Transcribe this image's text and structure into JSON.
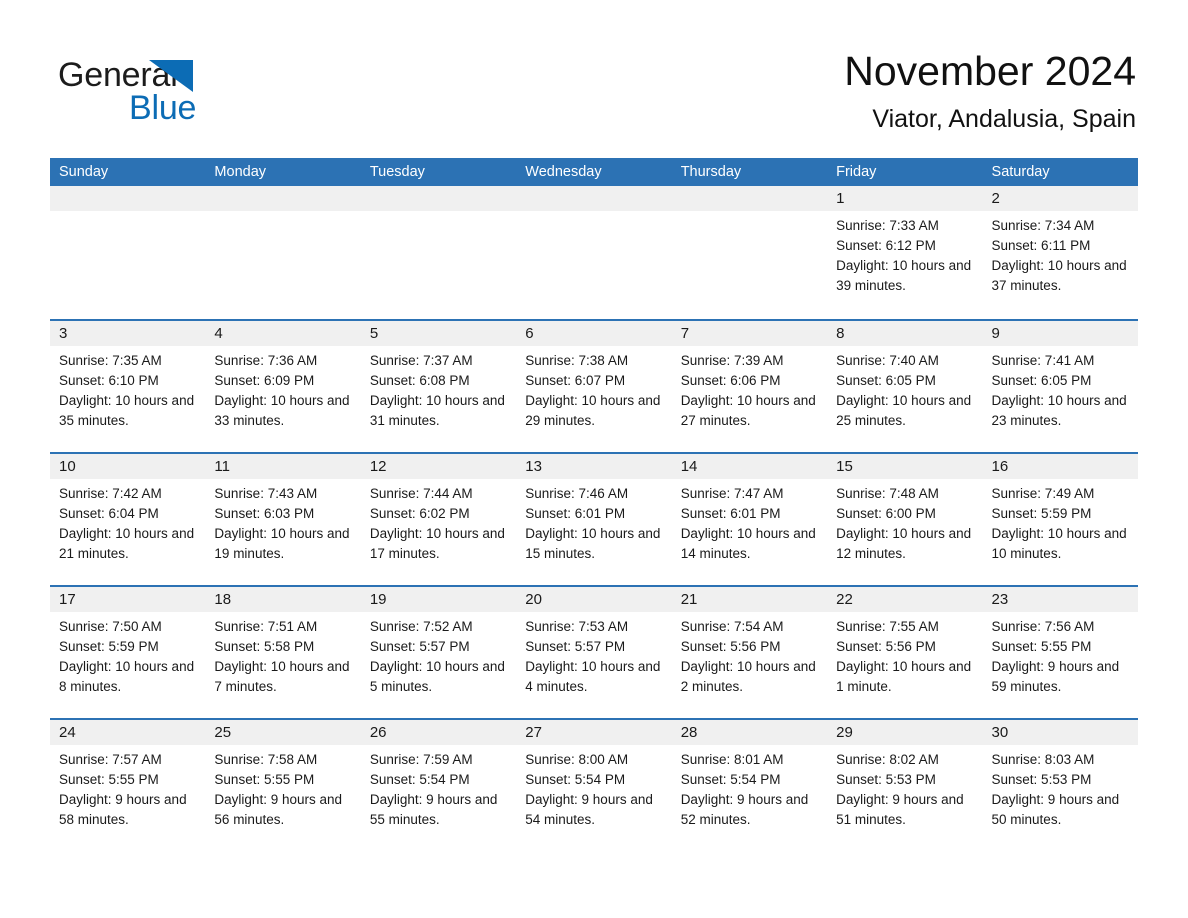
{
  "brand": {
    "name_part1": "General",
    "name_part2": "Blue",
    "accent_color": "#0c6cb5"
  },
  "header": {
    "month_title": "November 2024",
    "location": "Viator, Andalusia, Spain"
  },
  "theme": {
    "header_blue": "#2c72b4",
    "day_band_gray": "#f0f0f0",
    "row_border_blue": "#2c72b4"
  },
  "weekdays": [
    "Sunday",
    "Monday",
    "Tuesday",
    "Wednesday",
    "Thursday",
    "Friday",
    "Saturday"
  ],
  "weeks": [
    [
      {
        "day": "",
        "sunrise": "",
        "sunset": "",
        "daylight": ""
      },
      {
        "day": "",
        "sunrise": "",
        "sunset": "",
        "daylight": ""
      },
      {
        "day": "",
        "sunrise": "",
        "sunset": "",
        "daylight": ""
      },
      {
        "day": "",
        "sunrise": "",
        "sunset": "",
        "daylight": ""
      },
      {
        "day": "",
        "sunrise": "",
        "sunset": "",
        "daylight": ""
      },
      {
        "day": "1",
        "sunrise": "Sunrise: 7:33 AM",
        "sunset": "Sunset: 6:12 PM",
        "daylight": "Daylight: 10 hours and 39 minutes."
      },
      {
        "day": "2",
        "sunrise": "Sunrise: 7:34 AM",
        "sunset": "Sunset: 6:11 PM",
        "daylight": "Daylight: 10 hours and 37 minutes."
      }
    ],
    [
      {
        "day": "3",
        "sunrise": "Sunrise: 7:35 AM",
        "sunset": "Sunset: 6:10 PM",
        "daylight": "Daylight: 10 hours and 35 minutes."
      },
      {
        "day": "4",
        "sunrise": "Sunrise: 7:36 AM",
        "sunset": "Sunset: 6:09 PM",
        "daylight": "Daylight: 10 hours and 33 minutes."
      },
      {
        "day": "5",
        "sunrise": "Sunrise: 7:37 AM",
        "sunset": "Sunset: 6:08 PM",
        "daylight": "Daylight: 10 hours and 31 minutes."
      },
      {
        "day": "6",
        "sunrise": "Sunrise: 7:38 AM",
        "sunset": "Sunset: 6:07 PM",
        "daylight": "Daylight: 10 hours and 29 minutes."
      },
      {
        "day": "7",
        "sunrise": "Sunrise: 7:39 AM",
        "sunset": "Sunset: 6:06 PM",
        "daylight": "Daylight: 10 hours and 27 minutes."
      },
      {
        "day": "8",
        "sunrise": "Sunrise: 7:40 AM",
        "sunset": "Sunset: 6:05 PM",
        "daylight": "Daylight: 10 hours and 25 minutes."
      },
      {
        "day": "9",
        "sunrise": "Sunrise: 7:41 AM",
        "sunset": "Sunset: 6:05 PM",
        "daylight": "Daylight: 10 hours and 23 minutes."
      }
    ],
    [
      {
        "day": "10",
        "sunrise": "Sunrise: 7:42 AM",
        "sunset": "Sunset: 6:04 PM",
        "daylight": "Daylight: 10 hours and 21 minutes."
      },
      {
        "day": "11",
        "sunrise": "Sunrise: 7:43 AM",
        "sunset": "Sunset: 6:03 PM",
        "daylight": "Daylight: 10 hours and 19 minutes."
      },
      {
        "day": "12",
        "sunrise": "Sunrise: 7:44 AM",
        "sunset": "Sunset: 6:02 PM",
        "daylight": "Daylight: 10 hours and 17 minutes."
      },
      {
        "day": "13",
        "sunrise": "Sunrise: 7:46 AM",
        "sunset": "Sunset: 6:01 PM",
        "daylight": "Daylight: 10 hours and 15 minutes."
      },
      {
        "day": "14",
        "sunrise": "Sunrise: 7:47 AM",
        "sunset": "Sunset: 6:01 PM",
        "daylight": "Daylight: 10 hours and 14 minutes."
      },
      {
        "day": "15",
        "sunrise": "Sunrise: 7:48 AM",
        "sunset": "Sunset: 6:00 PM",
        "daylight": "Daylight: 10 hours and 12 minutes."
      },
      {
        "day": "16",
        "sunrise": "Sunrise: 7:49 AM",
        "sunset": "Sunset: 5:59 PM",
        "daylight": "Daylight: 10 hours and 10 minutes."
      }
    ],
    [
      {
        "day": "17",
        "sunrise": "Sunrise: 7:50 AM",
        "sunset": "Sunset: 5:59 PM",
        "daylight": "Daylight: 10 hours and 8 minutes."
      },
      {
        "day": "18",
        "sunrise": "Sunrise: 7:51 AM",
        "sunset": "Sunset: 5:58 PM",
        "daylight": "Daylight: 10 hours and 7 minutes."
      },
      {
        "day": "19",
        "sunrise": "Sunrise: 7:52 AM",
        "sunset": "Sunset: 5:57 PM",
        "daylight": "Daylight: 10 hours and 5 minutes."
      },
      {
        "day": "20",
        "sunrise": "Sunrise: 7:53 AM",
        "sunset": "Sunset: 5:57 PM",
        "daylight": "Daylight: 10 hours and 4 minutes."
      },
      {
        "day": "21",
        "sunrise": "Sunrise: 7:54 AM",
        "sunset": "Sunset: 5:56 PM",
        "daylight": "Daylight: 10 hours and 2 minutes."
      },
      {
        "day": "22",
        "sunrise": "Sunrise: 7:55 AM",
        "sunset": "Sunset: 5:56 PM",
        "daylight": "Daylight: 10 hours and 1 minute."
      },
      {
        "day": "23",
        "sunrise": "Sunrise: 7:56 AM",
        "sunset": "Sunset: 5:55 PM",
        "daylight": "Daylight: 9 hours and 59 minutes."
      }
    ],
    [
      {
        "day": "24",
        "sunrise": "Sunrise: 7:57 AM",
        "sunset": "Sunset: 5:55 PM",
        "daylight": "Daylight: 9 hours and 58 minutes."
      },
      {
        "day": "25",
        "sunrise": "Sunrise: 7:58 AM",
        "sunset": "Sunset: 5:55 PM",
        "daylight": "Daylight: 9 hours and 56 minutes."
      },
      {
        "day": "26",
        "sunrise": "Sunrise: 7:59 AM",
        "sunset": "Sunset: 5:54 PM",
        "daylight": "Daylight: 9 hours and 55 minutes."
      },
      {
        "day": "27",
        "sunrise": "Sunrise: 8:00 AM",
        "sunset": "Sunset: 5:54 PM",
        "daylight": "Daylight: 9 hours and 54 minutes."
      },
      {
        "day": "28",
        "sunrise": "Sunrise: 8:01 AM",
        "sunset": "Sunset: 5:54 PM",
        "daylight": "Daylight: 9 hours and 52 minutes."
      },
      {
        "day": "29",
        "sunrise": "Sunrise: 8:02 AM",
        "sunset": "Sunset: 5:53 PM",
        "daylight": "Daylight: 9 hours and 51 minutes."
      },
      {
        "day": "30",
        "sunrise": "Sunrise: 8:03 AM",
        "sunset": "Sunset: 5:53 PM",
        "daylight": "Daylight: 9 hours and 50 minutes."
      }
    ]
  ]
}
